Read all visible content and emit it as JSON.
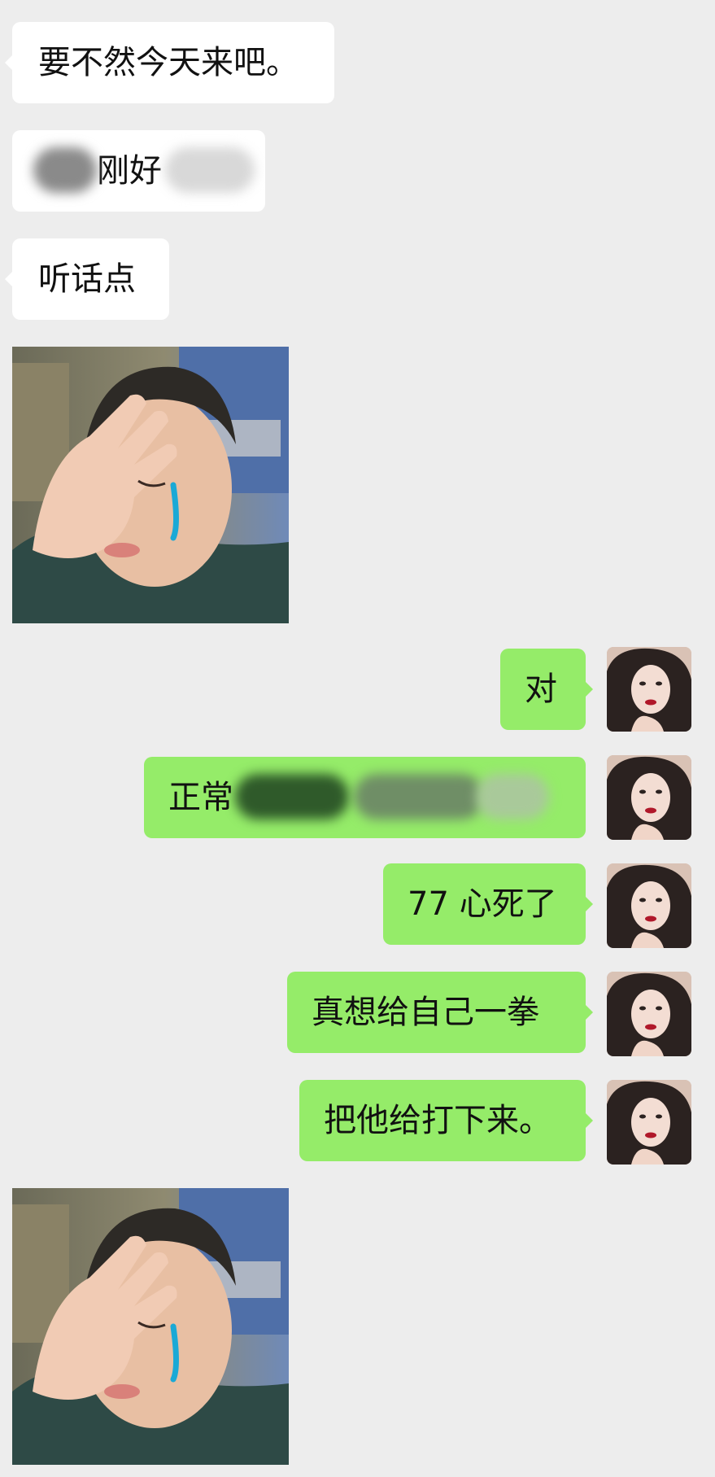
{
  "messages": [
    {
      "side": "incoming",
      "type": "text",
      "text": "要不然今天来吧。"
    },
    {
      "side": "incoming",
      "type": "text",
      "text_visible": "刚好",
      "redacted": true
    },
    {
      "side": "incoming",
      "type": "text",
      "text": "听话点"
    },
    {
      "side": "incoming",
      "type": "sticker",
      "sticker": "crying-boy-sticker"
    },
    {
      "side": "outgoing",
      "type": "text",
      "text": "对"
    },
    {
      "side": "outgoing",
      "type": "text",
      "text_visible": "正常",
      "redacted": true
    },
    {
      "side": "outgoing",
      "type": "text",
      "text": "77 心死了"
    },
    {
      "side": "outgoing",
      "type": "text",
      "text": "真想给自己一拳"
    },
    {
      "side": "outgoing",
      "type": "text",
      "text": "把他给打下来。"
    },
    {
      "side": "incoming",
      "type": "sticker",
      "sticker": "crying-boy-sticker"
    }
  ],
  "colors": {
    "background": "#ededed",
    "incoming_bubble": "#ffffff",
    "outgoing_bubble": "#95ec69",
    "text": "#111111"
  },
  "icons": {
    "avatar": "user-avatar-portrait",
    "sticker": "crying-boy-sticker"
  }
}
